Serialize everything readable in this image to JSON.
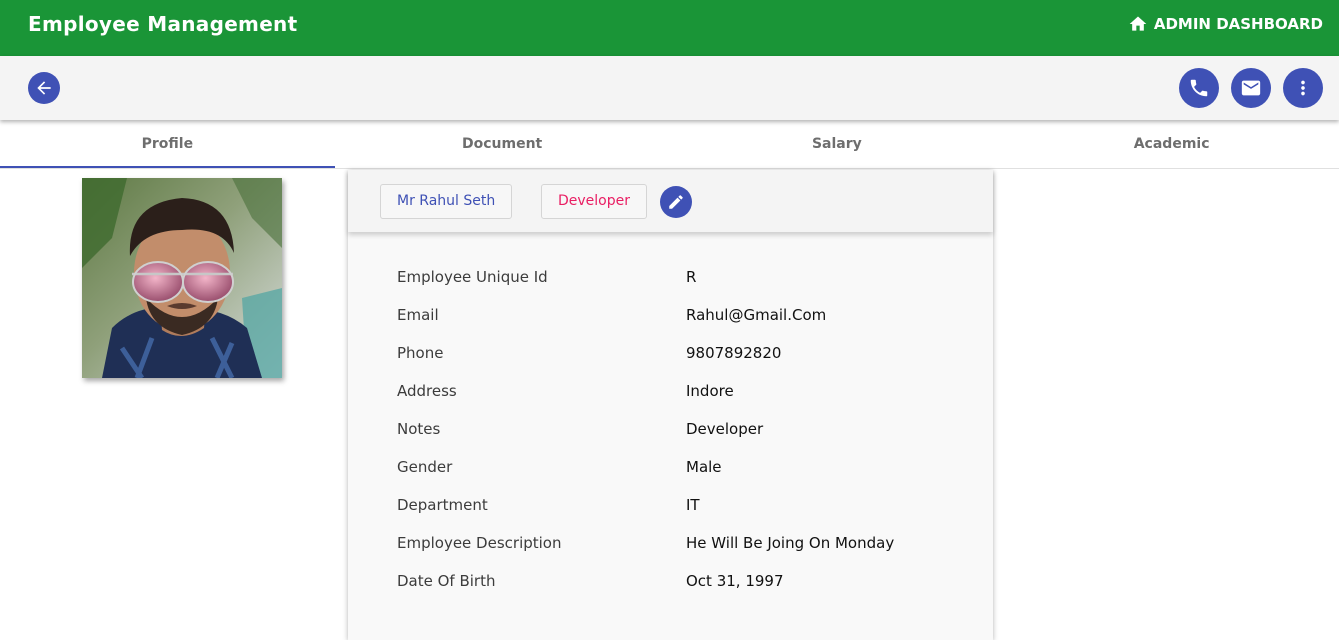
{
  "header": {
    "title": "Employee Management",
    "admin_label": "ADMIN DASHBOARD"
  },
  "tabs": [
    {
      "label": "Profile",
      "active": true
    },
    {
      "label": "Document",
      "active": false
    },
    {
      "label": "Salary",
      "active": false
    },
    {
      "label": "Academic",
      "active": false
    }
  ],
  "profile": {
    "name_chip": "Mr Rahul Seth",
    "role_chip": "Developer",
    "fields": [
      {
        "label": "Employee Unique Id",
        "value": "R"
      },
      {
        "label": "Email",
        "value": "Rahul@Gmail.Com"
      },
      {
        "label": "Phone",
        "value": "9807892820"
      },
      {
        "label": "Address",
        "value": "Indore"
      },
      {
        "label": "Notes",
        "value": "Developer"
      },
      {
        "label": "Gender",
        "value": "Male"
      },
      {
        "label": "Department",
        "value": "IT"
      },
      {
        "label": "Employee Description",
        "value": "He Will Be Joing On Monday"
      },
      {
        "label": "Date Of Birth",
        "value": "Oct 31, 1997"
      }
    ]
  },
  "icons": {
    "back": "arrow-left-icon",
    "home": "home-icon",
    "phone": "phone-icon",
    "mail": "mail-icon",
    "more": "more-vert-icon",
    "edit": "pencil-icon"
  },
  "colors": {
    "header_bg": "#1a9537",
    "accent": "#3f51b5",
    "role_chip": "#e91e63"
  }
}
